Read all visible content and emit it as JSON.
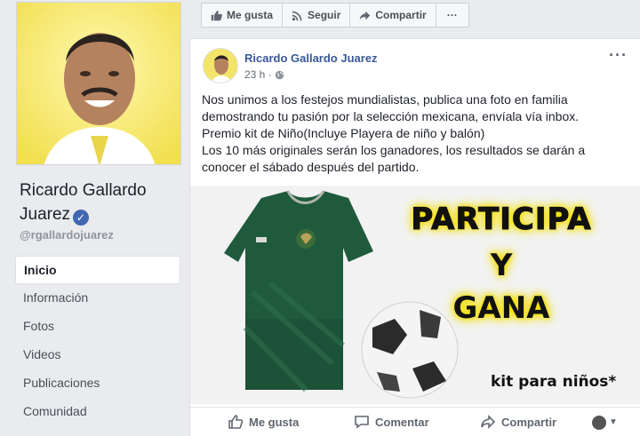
{
  "page": {
    "name": "Ricardo Gallardo Juarez",
    "handle": "@rgallardojuarez",
    "verified_icon": "verified-check-icon"
  },
  "topbar": {
    "like": "Me gusta",
    "follow": "Seguir",
    "share": "Compartir",
    "more": "···"
  },
  "nav": {
    "items": [
      {
        "label": "Inicio",
        "active": true
      },
      {
        "label": "Información"
      },
      {
        "label": "Fotos"
      },
      {
        "label": "Videos"
      },
      {
        "label": "Publicaciones"
      },
      {
        "label": "Comunidad"
      }
    ]
  },
  "post": {
    "author": "Ricardo Gallardo Juarez",
    "time": "23 h ·",
    "more": "···",
    "lines": [
      "Nos unimos a los festejos mundialistas, publica una foto en familia",
      "demostrando tu pasión por la selección mexicana, envíala vía inbox.",
      "Premio kit de Niño(Incluye Playera de niño y balón)",
      "Los 10 más originales serán los ganadores, los resultados se darán a",
      "conocer el sábado después del partido."
    ],
    "image": {
      "line1": "PARTICIPA",
      "line2": "Y",
      "line3": "GANA",
      "kit": "kit para niños*"
    },
    "actions": {
      "like": "Me gusta",
      "comment": "Comentar",
      "share": "Compartir"
    }
  },
  "colors": {
    "link": "#385898",
    "verified": "#4267b2",
    "promo_glow": "#f4e000",
    "jersey": "#1f5a3c"
  }
}
